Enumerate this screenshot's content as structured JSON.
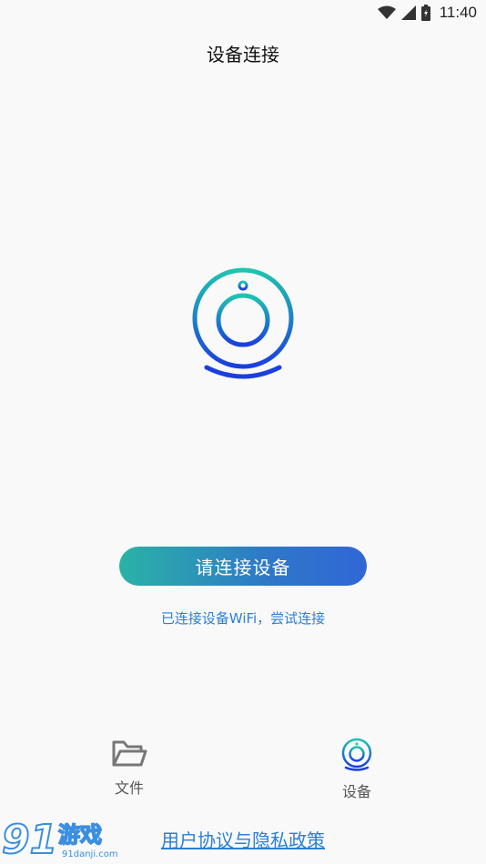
{
  "status_bar": {
    "time": "11:40",
    "icons": [
      "wifi-icon",
      "signal-icon",
      "battery-icon"
    ]
  },
  "header": {
    "title": "设备连接"
  },
  "main": {
    "illustration_icon": "camera-device-icon",
    "connect_button_label": "请连接设备",
    "wifi_link_text": "已连接设备WiFi，尝试连接"
  },
  "nav": {
    "items": [
      {
        "label": "文件",
        "icon": "folder-icon",
        "active": false
      },
      {
        "label": "设备",
        "icon": "camera-device-icon",
        "active": true
      }
    ]
  },
  "footer": {
    "privacy_link_text": "用户协议与隐私政策"
  },
  "watermark": {
    "logo_text": "91游戏",
    "site_text": "91danji.com"
  },
  "colors": {
    "accent_blue": "#2b7fd6",
    "gradient_start": "#2ab3a6",
    "gradient_end": "#3066d6",
    "device_ring_top": "#1fc4b0",
    "device_ring_bottom": "#1a3fe0"
  }
}
